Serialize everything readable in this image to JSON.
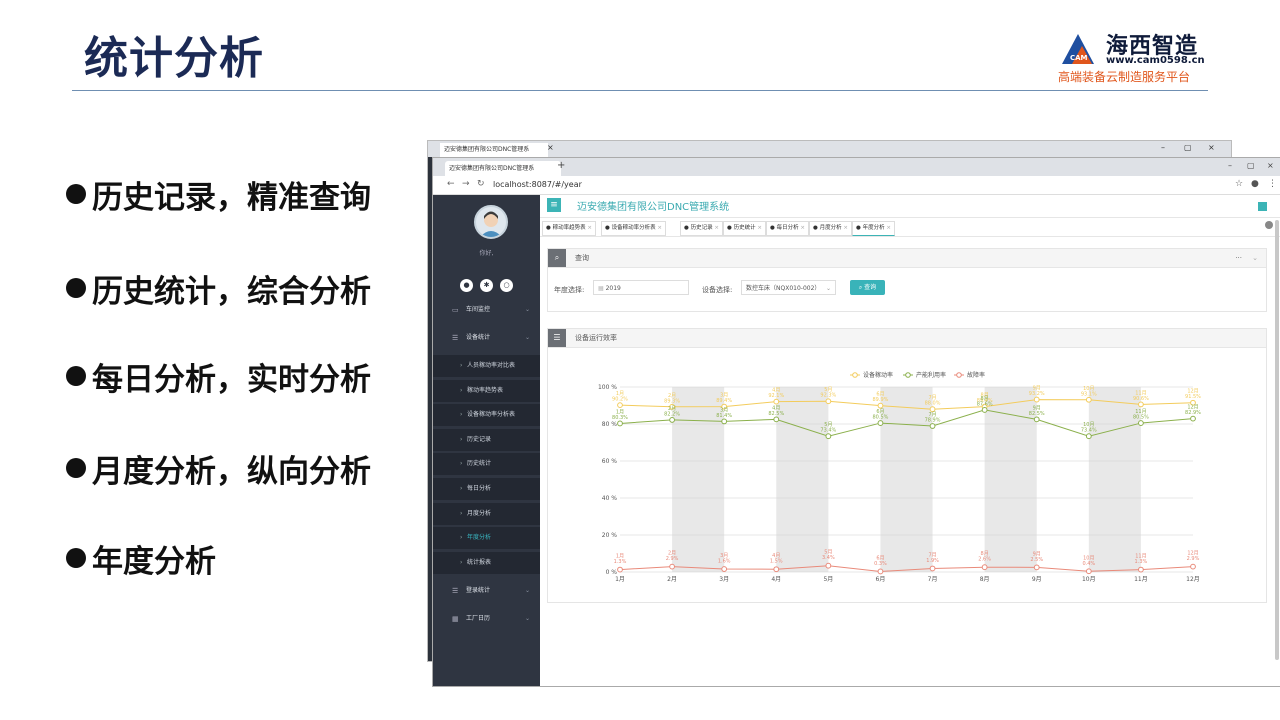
{
  "slide": {
    "title": "统计分析",
    "bullets": [
      "历史记录，精准查询",
      "历史统计，综合分析",
      "每日分析，实时分析",
      "月度分析，纵向分析",
      "年度分析"
    ]
  },
  "logo": {
    "mark_text": "CAM",
    "brand": "海西智造",
    "url": "www.cam0598.cn",
    "tagline": "高端装备云制造服务平台"
  },
  "browser": {
    "tab_title": "迈安德集团有限公司DNC管理系",
    "url": "localhost:8087/#/year"
  },
  "app": {
    "system_title": "迈安德集团有限公司DNC管理系统",
    "greeting": "你好,",
    "sidebar": [
      {
        "label": "车间监控",
        "icon": "monitor-icon",
        "type": "group"
      },
      {
        "label": "设备统计",
        "icon": "list-icon",
        "type": "group"
      },
      {
        "label": "人员稼动率对比表",
        "type": "sub"
      },
      {
        "label": "稼动率趋势表",
        "type": "sub"
      },
      {
        "label": "设备稼动率分析表",
        "type": "sub"
      },
      {
        "label": "历史记录",
        "type": "sub"
      },
      {
        "label": "历史统计",
        "type": "sub"
      },
      {
        "label": "每日分析",
        "type": "sub"
      },
      {
        "label": "月度分析",
        "type": "sub"
      },
      {
        "label": "年度分析",
        "type": "sub",
        "active": true
      },
      {
        "label": "统计报表",
        "type": "sub"
      },
      {
        "label": "登录统计",
        "icon": "list-icon",
        "type": "group"
      },
      {
        "label": "工厂日历",
        "icon": "calendar-icon",
        "type": "group"
      }
    ],
    "page_tabs": [
      "稼动率趋势表",
      "设备稼动率分析表",
      "历史记录",
      "历史统计",
      "每日分析",
      "月度分析",
      "年度分析"
    ],
    "query": {
      "panel_title": "查询",
      "more": "···",
      "year_label": "年度选择:",
      "year_value": "2019",
      "device_label": "设备选择:",
      "device_value": "数控车床（NQX010-002）",
      "search_button": "查询"
    },
    "chart_panel_title": "设备运行效率"
  },
  "chart_data": {
    "type": "line",
    "categories": [
      "1月",
      "2月",
      "3月",
      "4月",
      "5月",
      "6月",
      "7月",
      "8月",
      "9月",
      "10月",
      "11月",
      "12月"
    ],
    "y_tick_labels": [
      "0 %",
      "20 %",
      "40 %",
      "60 %",
      "80 %",
      "100 %"
    ],
    "ylim": [
      0,
      100
    ],
    "legend_position": "top",
    "series": [
      {
        "name": "设备稼动率",
        "color": "#f3cc5c",
        "values": [
          90.2,
          89.3,
          89.4,
          92.1,
          92.3,
          89.9,
          88.0,
          89.4,
          93.2,
          93.1,
          90.6,
          91.5
        ],
        "labels": [
          "90.2%",
          "89.3%",
          "89.4%",
          "92.1%",
          "92.3%",
          "89.9%",
          "88.0%",
          "89.4%",
          "93.2%",
          "93.1%",
          "90.6%",
          "91.5%"
        ]
      },
      {
        "name": "产能利用率",
        "color": "#8bb04c",
        "values": [
          80.3,
          82.2,
          81.4,
          82.5,
          73.4,
          80.5,
          78.9,
          87.6,
          82.5,
          73.4,
          80.5,
          82.9
        ],
        "labels": [
          "80.3%",
          "82.2%",
          "81.4%",
          "82.5%",
          "73.4%",
          "80.5%",
          "78.9%",
          "87.6%",
          "82.5%",
          "73.4%",
          "80.5%",
          "82.9%"
        ]
      },
      {
        "name": "故障率",
        "color": "#e98a7a",
        "values": [
          1.3,
          2.9,
          1.6,
          1.5,
          3.4,
          0.3,
          1.9,
          2.6,
          2.5,
          0.4,
          1.3,
          2.9
        ],
        "labels": [
          "1.3%",
          "2.9%",
          "1.6%",
          "1.5%",
          "3.4%",
          "0.3%",
          "1.9%",
          "2.6%",
          "2.5%",
          "0.4%",
          "1.3%",
          "2.9%"
        ]
      }
    ]
  }
}
